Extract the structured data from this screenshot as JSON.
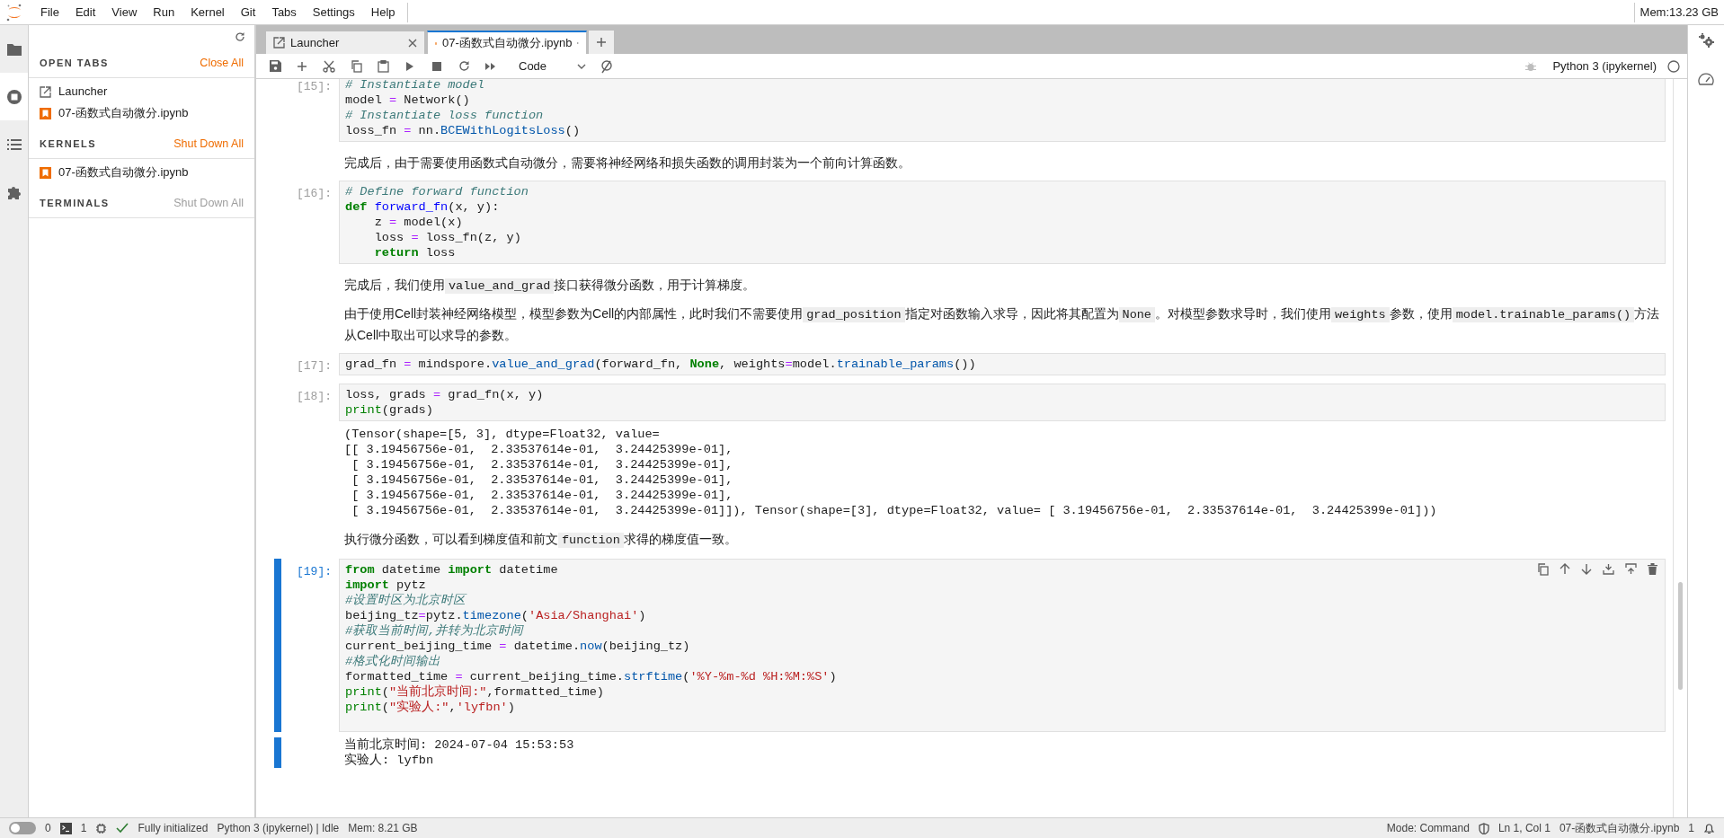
{
  "menu_bar": {
    "items": [
      "File",
      "Edit",
      "View",
      "Run",
      "Kernel",
      "Git",
      "Tabs",
      "Settings",
      "Help"
    ],
    "memory": "Mem:13.23 GB"
  },
  "activity_bar": [
    {
      "kind": "folder",
      "selected": false
    },
    {
      "kind": "running",
      "selected": true
    },
    {
      "kind": "toc",
      "selected": false
    },
    {
      "kind": "extensions",
      "selected": false
    }
  ],
  "sidebar": {
    "sections": [
      {
        "title": "OPEN TABS",
        "action": "Close All",
        "action_enabled": true,
        "items": [
          {
            "kind": "launcher",
            "label": "Launcher"
          },
          {
            "kind": "notebook",
            "label": "07-函数式自动微分.ipynb"
          }
        ]
      },
      {
        "title": "KERNELS",
        "action": "Shut Down All",
        "action_enabled": true,
        "items": [
          {
            "kind": "notebook",
            "label": "07-函数式自动微分.ipynb"
          }
        ]
      },
      {
        "title": "TERMINALS",
        "action": "Shut Down All",
        "action_enabled": false
      }
    ]
  },
  "tabs": [
    {
      "kind": "launcher",
      "label": "Launcher",
      "selected": false,
      "dirty": false
    },
    {
      "kind": "notebook",
      "label": "07-函数式自动微分.ipynb",
      "selected": true,
      "dirty": true
    }
  ],
  "toolbar": {
    "cell_type": "Code",
    "kernel": "Python 3 (ipykernel)",
    "kernel_busy": false
  },
  "cells": [
    {
      "kind": "code",
      "prompt": "[15]:",
      "active": false,
      "lines": [
        [
          {
            "kind": "comment",
            "text": "# Instantiate model"
          }
        ],
        [
          {
            "kind": "plain",
            "text": "model "
          },
          {
            "kind": "operator",
            "text": "="
          },
          {
            "kind": "plain",
            "text": " Network()"
          }
        ],
        [
          {
            "kind": "comment",
            "text": "# Instantiate loss function"
          }
        ],
        [
          {
            "kind": "plain",
            "text": "loss_fn "
          },
          {
            "kind": "operator",
            "text": "="
          },
          {
            "kind": "plain",
            "text": " nn."
          },
          {
            "kind": "attribute",
            "text": "BCEWithLogitsLoss"
          },
          {
            "kind": "plain",
            "text": "()"
          }
        ]
      ]
    },
    {
      "kind": "markdown",
      "paragraphs": [
        [
          {
            "kind": "text",
            "text": "完成后，由于需要使用函数式自动微分，需要将神经网络和损失函数的调用封装为一个前向计算函数。"
          }
        ]
      ]
    },
    {
      "kind": "code",
      "prompt": "[16]:",
      "active": false,
      "lines": [
        [
          {
            "kind": "comment",
            "text": "# Define forward function"
          }
        ],
        [
          {
            "kind": "keyword",
            "text": "def"
          },
          {
            "kind": "definition",
            "text": " forward_fn"
          },
          {
            "kind": "plain",
            "text": "(x, y):"
          }
        ],
        [
          {
            "kind": "plain",
            "text": "    z "
          },
          {
            "kind": "operator",
            "text": "="
          },
          {
            "kind": "plain",
            "text": " model(x)"
          }
        ],
        [
          {
            "kind": "plain",
            "text": "    loss "
          },
          {
            "kind": "operator",
            "text": "="
          },
          {
            "kind": "plain",
            "text": " loss_fn(z, y)"
          }
        ],
        [
          {
            "kind": "keyword",
            "text": "    return"
          },
          {
            "kind": "plain",
            "text": " loss"
          }
        ]
      ]
    },
    {
      "kind": "markdown",
      "paragraphs": [
        [
          {
            "kind": "text",
            "text": "完成后，我们使用"
          },
          {
            "kind": "code",
            "text": "value_and_grad"
          },
          {
            "kind": "text",
            "text": "接口获得微分函数，用于计算梯度。"
          }
        ],
        [
          {
            "kind": "text",
            "text": "由于使用Cell封装神经网络模型，模型参数为Cell的内部属性，此时我们不需要使用"
          },
          {
            "kind": "code",
            "text": "grad_position"
          },
          {
            "kind": "text",
            "text": "指定对函数输入求导，因此将其配置为"
          },
          {
            "kind": "code",
            "text": "None"
          },
          {
            "kind": "text",
            "text": "。对模型参数求导时，我们使用"
          },
          {
            "kind": "code",
            "text": "weights"
          },
          {
            "kind": "text",
            "text": "参数，使用"
          },
          {
            "kind": "code",
            "text": "model.trainable_params()"
          },
          {
            "kind": "text",
            "text": "方法从Cell中取出可以求导的参数。"
          }
        ]
      ]
    },
    {
      "kind": "code",
      "prompt": "[17]:",
      "active": false,
      "lines": [
        [
          {
            "kind": "plain",
            "text": "grad_fn "
          },
          {
            "kind": "operator",
            "text": "="
          },
          {
            "kind": "plain",
            "text": " mindspore."
          },
          {
            "kind": "attribute",
            "text": "value_and_grad"
          },
          {
            "kind": "plain",
            "text": "(forward_fn, "
          },
          {
            "kind": "keyword",
            "text": "None"
          },
          {
            "kind": "plain",
            "text": ", weights"
          },
          {
            "kind": "operator",
            "text": "="
          },
          {
            "kind": "plain",
            "text": "model."
          },
          {
            "kind": "attribute",
            "text": "trainable_params"
          },
          {
            "kind": "plain",
            "text": "())"
          }
        ]
      ]
    },
    {
      "kind": "code",
      "prompt": "[18]:",
      "active": false,
      "lines": [
        [
          {
            "kind": "plain",
            "text": "loss, grads "
          },
          {
            "kind": "operator",
            "text": "="
          },
          {
            "kind": "plain",
            "text": " grad_fn(x, y)"
          }
        ],
        [
          {
            "kind": "builtin",
            "text": "print"
          },
          {
            "kind": "plain",
            "text": "(grads)"
          }
        ]
      ],
      "output": [
        "(Tensor(shape=[5, 3], dtype=Float32, value=",
        "[[ 3.19456756e-01,  2.33537614e-01,  3.24425399e-01],",
        " [ 3.19456756e-01,  2.33537614e-01,  3.24425399e-01],",
        " [ 3.19456756e-01,  2.33537614e-01,  3.24425399e-01],",
        " [ 3.19456756e-01,  2.33537614e-01,  3.24425399e-01],",
        " [ 3.19456756e-01,  2.33537614e-01,  3.24425399e-01]]), Tensor(shape=[3], dtype=Float32, value= [ 3.19456756e-01,  2.33537614e-01,  3.24425399e-01]))"
      ]
    },
    {
      "kind": "markdown",
      "paragraphs": [
        [
          {
            "kind": "text",
            "text": "执行微分函数，可以看到梯度值和前文"
          },
          {
            "kind": "code",
            "text": "function"
          },
          {
            "kind": "text",
            "text": "求得的梯度值一致。"
          }
        ]
      ]
    },
    {
      "kind": "code",
      "prompt": "[19]:",
      "active": true,
      "lines": [
        [
          {
            "kind": "keyword",
            "text": "from"
          },
          {
            "kind": "plain",
            "text": " datetime "
          },
          {
            "kind": "keyword",
            "text": "import"
          },
          {
            "kind": "plain",
            "text": " datetime"
          }
        ],
        [
          {
            "kind": "keyword",
            "text": "import"
          },
          {
            "kind": "plain",
            "text": " pytz"
          }
        ],
        [
          {
            "kind": "comment",
            "text": "#设置时区为北京时区"
          }
        ],
        [
          {
            "kind": "plain",
            "text": "beijing_tz"
          },
          {
            "kind": "operator",
            "text": "="
          },
          {
            "kind": "plain",
            "text": "pytz."
          },
          {
            "kind": "attribute",
            "text": "timezone"
          },
          {
            "kind": "plain",
            "text": "("
          },
          {
            "kind": "string",
            "text": "'Asia/Shanghai'"
          },
          {
            "kind": "plain",
            "text": ")"
          }
        ],
        [
          {
            "kind": "comment",
            "text": "#获取当前时间,并转为北京时间"
          }
        ],
        [
          {
            "kind": "plain",
            "text": "current_beijing_time "
          },
          {
            "kind": "operator",
            "text": "="
          },
          {
            "kind": "plain",
            "text": " datetime."
          },
          {
            "kind": "attribute",
            "text": "now"
          },
          {
            "kind": "plain",
            "text": "(beijing_tz)"
          }
        ],
        [
          {
            "kind": "comment",
            "text": "#格式化时间输出"
          }
        ],
        [
          {
            "kind": "plain",
            "text": "formatted_time "
          },
          {
            "kind": "operator",
            "text": "="
          },
          {
            "kind": "plain",
            "text": " current_beijing_time."
          },
          {
            "kind": "attribute",
            "text": "strftime"
          },
          {
            "kind": "plain",
            "text": "("
          },
          {
            "kind": "string",
            "text": "'%Y-%m-%d %H:%M:%S'"
          },
          {
            "kind": "plain",
            "text": ")"
          }
        ],
        [
          {
            "kind": "builtin",
            "text": "print"
          },
          {
            "kind": "plain",
            "text": "("
          },
          {
            "kind": "string",
            "text": "\"当前北京时间:\""
          },
          {
            "kind": "plain",
            "text": ",formatted_time)"
          }
        ],
        [
          {
            "kind": "builtin",
            "text": "print"
          },
          {
            "kind": "plain",
            "text": "("
          },
          {
            "kind": "string",
            "text": "\"实验人:\""
          },
          {
            "kind": "plain",
            "text": ","
          },
          {
            "kind": "string",
            "text": "'lyfbn'"
          },
          {
            "kind": "plain",
            "text": ")"
          }
        ]
      ],
      "output": [
        "当前北京时间: 2024-07-04 15:53:53",
        "实验人: lyfbn"
      ]
    }
  ],
  "status_bar": {
    "simple_mode": false,
    "terminals": "0",
    "kernels": "1",
    "kernel_status": "Fully initialized",
    "kernel": "Python 3 (ipykernel) | Idle",
    "memory": "Mem: 8.21 GB",
    "mode": "Mode: Command",
    "position": "Ln 1, Col 1",
    "file": "07-函数式自动微分.ipynb",
    "notifications": "1"
  }
}
